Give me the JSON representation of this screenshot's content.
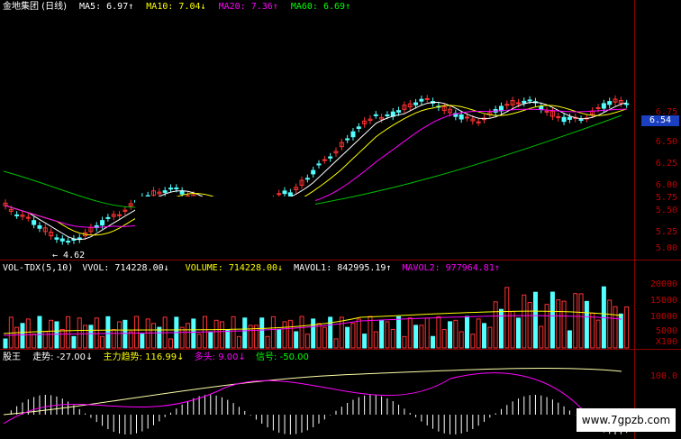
{
  "title": "金地集团 (日线)",
  "ma_header": {
    "ma5": {
      "label": "MA5:",
      "value": "6.97↑",
      "color": "#ffffff"
    },
    "ma10": {
      "label": "MA10:",
      "value": "7.04↓",
      "color": "#ffff00"
    },
    "ma20": {
      "label": "MA20:",
      "value": "7.36↑",
      "color": "#ff00ff"
    },
    "ma60": {
      "label": "MA60:",
      "value": "6.69↑",
      "color": "#00ff00"
    }
  },
  "price_axis": [
    "6.75",
    "6.50",
    "6.25",
    "6.00",
    "5.75",
    "5.50",
    "5.25",
    "5.00"
  ],
  "current_price": "6.54",
  "low_label": "4.62",
  "vol_header": {
    "name": "VOL-TDX(5,10)",
    "vvol": "VVOL: 714228.00↓",
    "volume": "VOLUME: 714228.00↓",
    "mavol1": "MAVOL1: 842995.19↑",
    "mavol2": "MAVOL2: 977964.81↑"
  },
  "vol_axis": [
    "20000",
    "15000",
    "10000",
    "5000",
    "X100"
  ],
  "ind_header": {
    "name": "股王",
    "trend": "走势: -27.00↓",
    "main": "主力趋势: 116.99↓",
    "long": "多头: 9.00↓",
    "signal": "信号: -50.00"
  },
  "ind_axis": [
    "100.0"
  ],
  "watermark": "www.7gpzb.com",
  "colors": {
    "up": "#ff3333",
    "down": "#54ffff",
    "grid": "#8b0000"
  }
}
